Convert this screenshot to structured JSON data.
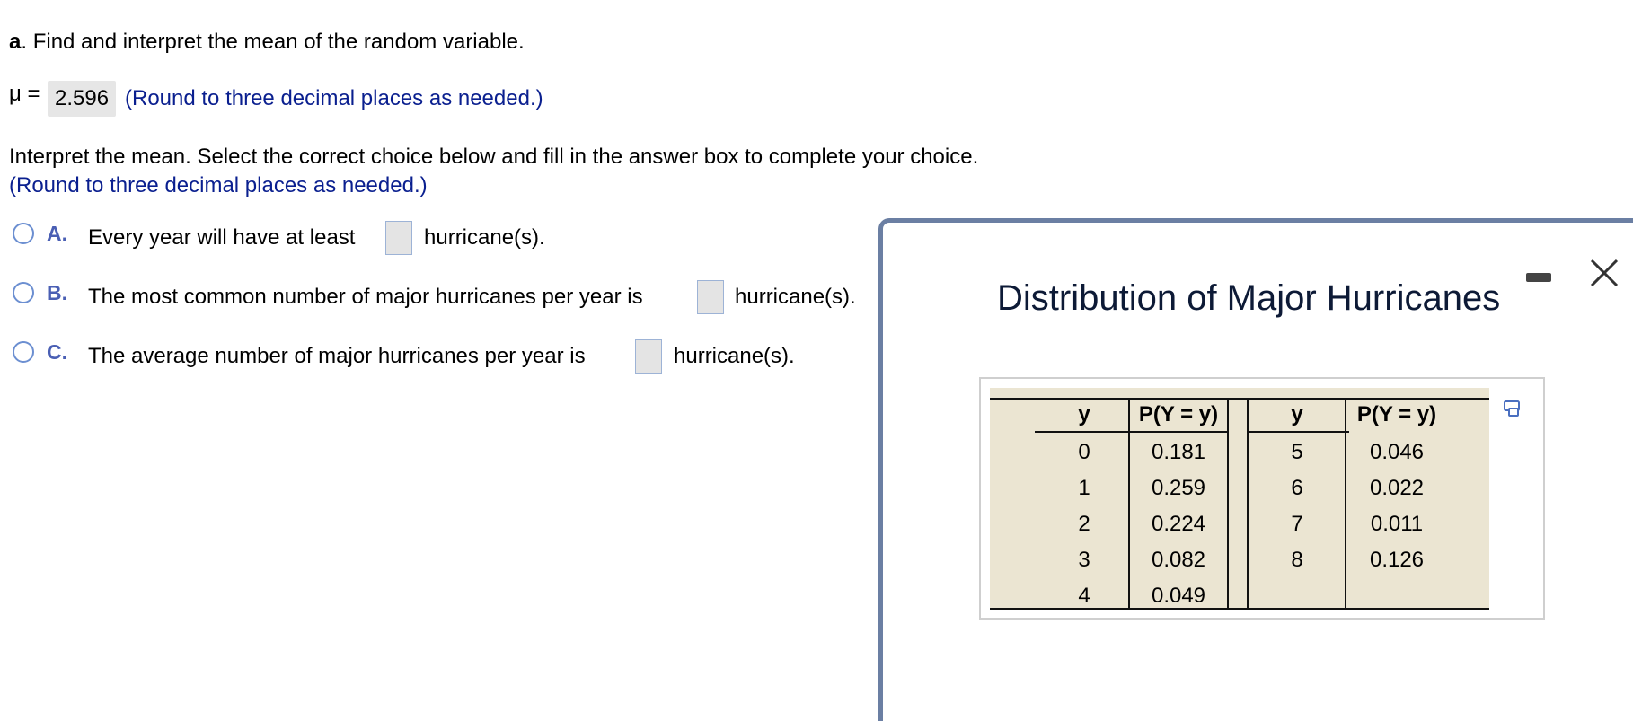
{
  "question": {
    "part_letter": "a",
    "part_text": ". Find and interpret the mean of the random variable.",
    "mu_label": "μ =",
    "mu_value": "2.596",
    "mu_hint": "(Round to three decimal places as needed.)",
    "interpret_text": "Interpret the mean. Select the correct choice below and fill in the answer box to complete your choice.",
    "interpret_hint": "(Round to three decimal places as needed.)"
  },
  "choices": [
    {
      "letter": "A.",
      "before": "Every year will have at least",
      "after": "hurricane(s)."
    },
    {
      "letter": "B.",
      "before": "The most common number of major hurricanes per year is",
      "after": "hurricane(s)."
    },
    {
      "letter": "C.",
      "before": "The average number of major hurricanes per year is",
      "after": "hurricane(s)."
    }
  ],
  "popup": {
    "title": "Distribution of Major Hurricanes",
    "minimize_icon": "minimize-icon",
    "close_icon": "close-icon",
    "copy_icon": "copy-icon",
    "table": {
      "headers": [
        "y",
        "P(Y = y)",
        "y",
        "P(Y = y)"
      ],
      "left_rows": [
        {
          "y": "0",
          "p": "0.181"
        },
        {
          "y": "1",
          "p": "0.259"
        },
        {
          "y": "2",
          "p": "0.224"
        },
        {
          "y": "3",
          "p": "0.082"
        },
        {
          "y": "4",
          "p": "0.049"
        }
      ],
      "right_rows": [
        {
          "y": "5",
          "p": "0.046"
        },
        {
          "y": "6",
          "p": "0.022"
        },
        {
          "y": "7",
          "p": "0.011"
        },
        {
          "y": "8",
          "p": "0.126"
        }
      ]
    }
  },
  "colors": {
    "hint_blue": "#0a1f8f",
    "table_bg": "#ebe5d2",
    "radio_border": "#6c8fd1"
  }
}
